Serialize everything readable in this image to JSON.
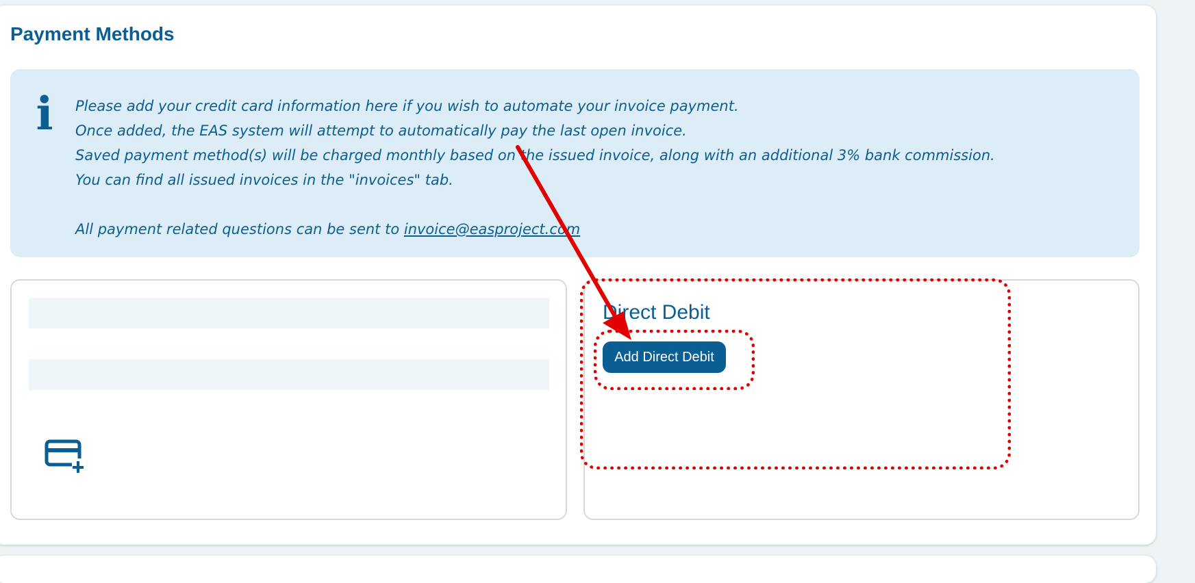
{
  "section": {
    "title": "Payment Methods"
  },
  "info": {
    "icon": "info-icon",
    "glyph": "i",
    "lines": [
      "Please add your credit card information here if you wish to automate your invoice payment.",
      "Once added, the EAS system will attempt to automatically pay the last open invoice.",
      "Saved payment method(s) will be charged monthly based on the issued invoice, along with an additional 3% bank commission.",
      "You can find all issued invoices in the \"invoices\" tab."
    ],
    "contact_prefix": "All payment related questions can be sent to ",
    "contact_email": "invoice@easproject.com"
  },
  "cards_panel": {
    "add_card_icon": "credit-card-add-icon"
  },
  "direct_debit": {
    "title": "Direct Debit",
    "button_label": "Add Direct Debit"
  },
  "colors": {
    "brand": "#0b5e91",
    "info_bg": "#dcedf8",
    "annotation": "#e30000"
  }
}
